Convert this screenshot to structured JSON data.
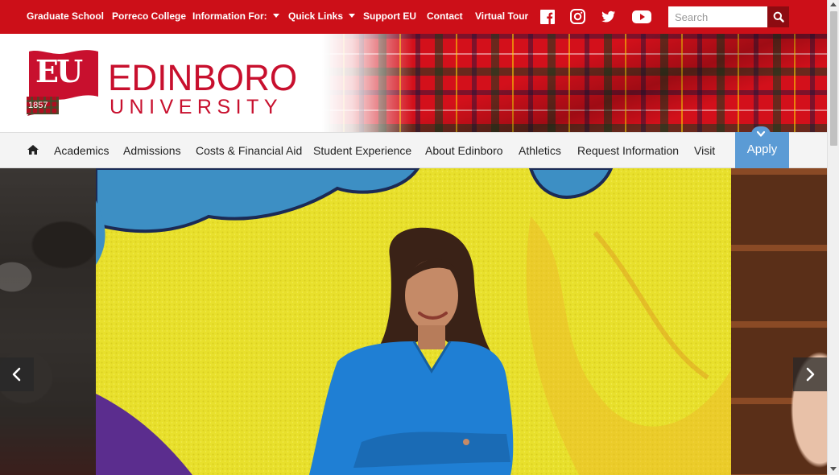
{
  "top_bar": {
    "links": [
      "Graduate School",
      "Porreco College",
      "Information For:",
      "Quick Links",
      "Support EU",
      "Contact",
      "Virtual Tour"
    ],
    "social_icons": [
      "facebook-icon",
      "instagram-icon",
      "twitter-icon",
      "youtube-icon"
    ],
    "search": {
      "placeholder": "Search",
      "value": ""
    },
    "colors": {
      "bar": "#cc0f18",
      "search_button": "#8d0b11"
    }
  },
  "logo": {
    "monogram": "EU",
    "year": "1857",
    "name": "EDINBORO",
    "subname": "UNIVERSITY",
    "color": "#c8102e"
  },
  "main_nav": {
    "items": [
      "Academics",
      "Admissions",
      "Costs & Financial Aid",
      "Student Experience",
      "About Edinboro",
      "Athletics",
      "Request Information",
      "Visit"
    ],
    "apply_label": "Apply",
    "apply_color": "#5b9bd5"
  },
  "hero": {
    "previous_icon": "chevron-left-icon",
    "next_icon": "chevron-right-icon"
  }
}
